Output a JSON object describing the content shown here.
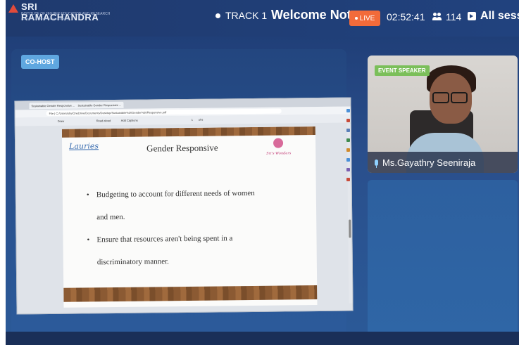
{
  "header": {
    "logo_name": "SRI RAMACHANDRA",
    "logo_subtitle": "INSTITUTE OF HIGHER EDUCATION AND RESEARCH",
    "logo_tagline": "(Category - I Deemed to be University)",
    "track_label": "TRACK 1",
    "session_title": "Welcome Note",
    "live_label": "LIVE",
    "timer": "02:52:41",
    "attendee_count": "114",
    "all_sessions_label": "All sessi"
  },
  "stage": {
    "cohost_badge": "CO-HOST",
    "browser": {
      "tabs": [
        "Sustainable Gender Responsive ...",
        "Sustainable Gender Responsive ..."
      ],
      "url": "File | C:/Users/shy/OneDrive/Documents/Desktop/Sustainable%20Gender%20Responsive.pdf",
      "toolbar_items": [
        "Draw",
        "Read aloud",
        "Add Captions",
        "1",
        "of 6"
      ]
    },
    "slide": {
      "logo_text": "Lauries",
      "title": "Gender Responsive",
      "badge_text": "Sri's Wonders",
      "bullets": [
        {
          "line1": "Budgeting to account for different needs of women",
          "line2": "and men."
        },
        {
          "line1": "Ensure that resources aren't being spent in a",
          "line2": "discriminatory manner."
        }
      ]
    }
  },
  "speaker": {
    "tag": "EVENT SPEAKER",
    "name": "Ms.Gayathry Seeniraja"
  }
}
